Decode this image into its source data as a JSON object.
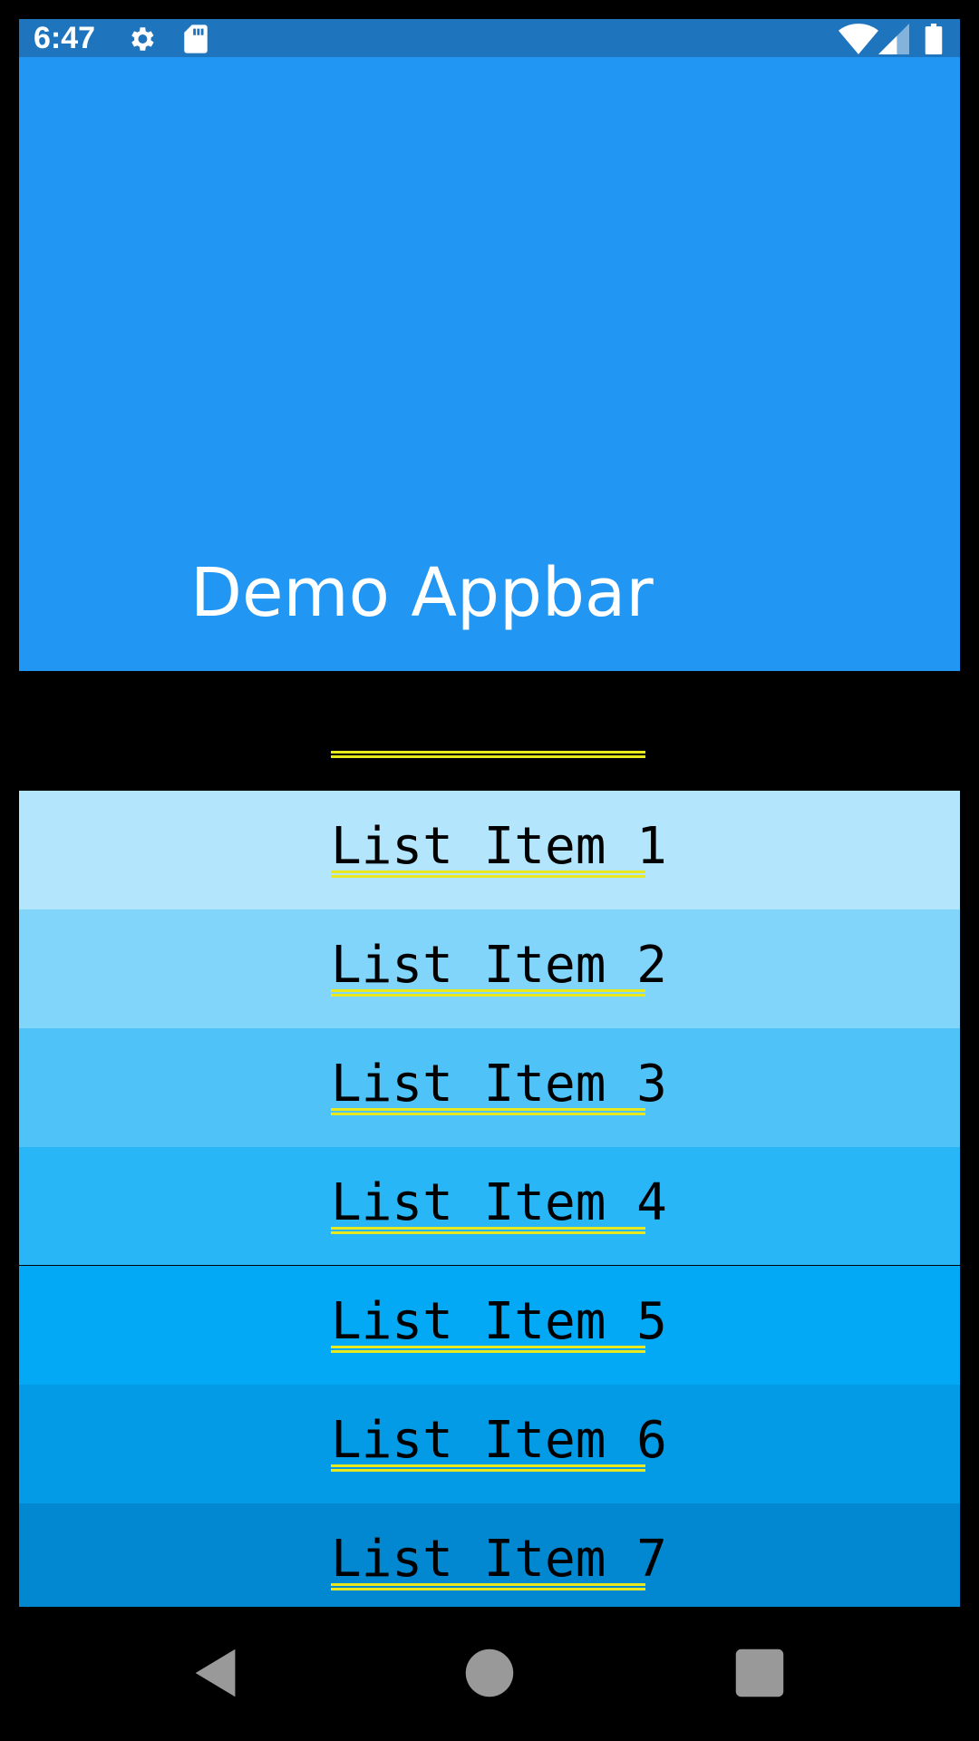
{
  "status_bar": {
    "time": "6:47",
    "icons": [
      "gear-icon",
      "sd-card-icon",
      "wifi-icon",
      "signal-icon",
      "battery-icon"
    ]
  },
  "appbar": {
    "title": "Demo Appbar",
    "color": "#2196f3"
  },
  "list": {
    "items": [
      {
        "label": "List Item 1",
        "color": "#b3e5fc"
      },
      {
        "label": "List Item 2",
        "color": "#81d4fa"
      },
      {
        "label": "List Item 3",
        "color": "#4fc3f7"
      },
      {
        "label": "List Item 4",
        "color": "#29b6f6"
      },
      {
        "label": "List Item 5",
        "color": "#03a9f4"
      },
      {
        "label": "List Item 6",
        "color": "#039be5"
      },
      {
        "label": "List Item 7",
        "color": "#0288d1"
      }
    ]
  },
  "nav_bar": {
    "buttons": [
      "back-icon",
      "home-icon",
      "recents-icon"
    ]
  }
}
